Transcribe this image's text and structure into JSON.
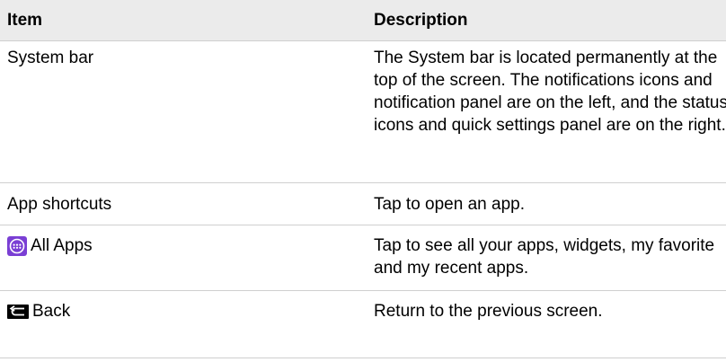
{
  "header": {
    "item": "Item",
    "description": "Description"
  },
  "rows": [
    {
      "item": "System bar",
      "description": "The System bar is located permanently at the top of the screen. The notifications icons and notification panel are on the left, and the status icons and quick settings panel are on the right."
    },
    {
      "item": "App shortcuts",
      "description": "Tap to open an app."
    },
    {
      "item": "All Apps",
      "icon": "all-apps-icon",
      "description": "Tap to see all your apps, widgets, my favorite and my recent apps."
    },
    {
      "item": "Back",
      "icon": "back-arrow-icon",
      "description": "Return to the previous screen."
    }
  ],
  "colors": {
    "header_background": "#ebebeb",
    "all_apps_icon_fill": "#7a3fd4",
    "divider": "#cfcfcf"
  }
}
